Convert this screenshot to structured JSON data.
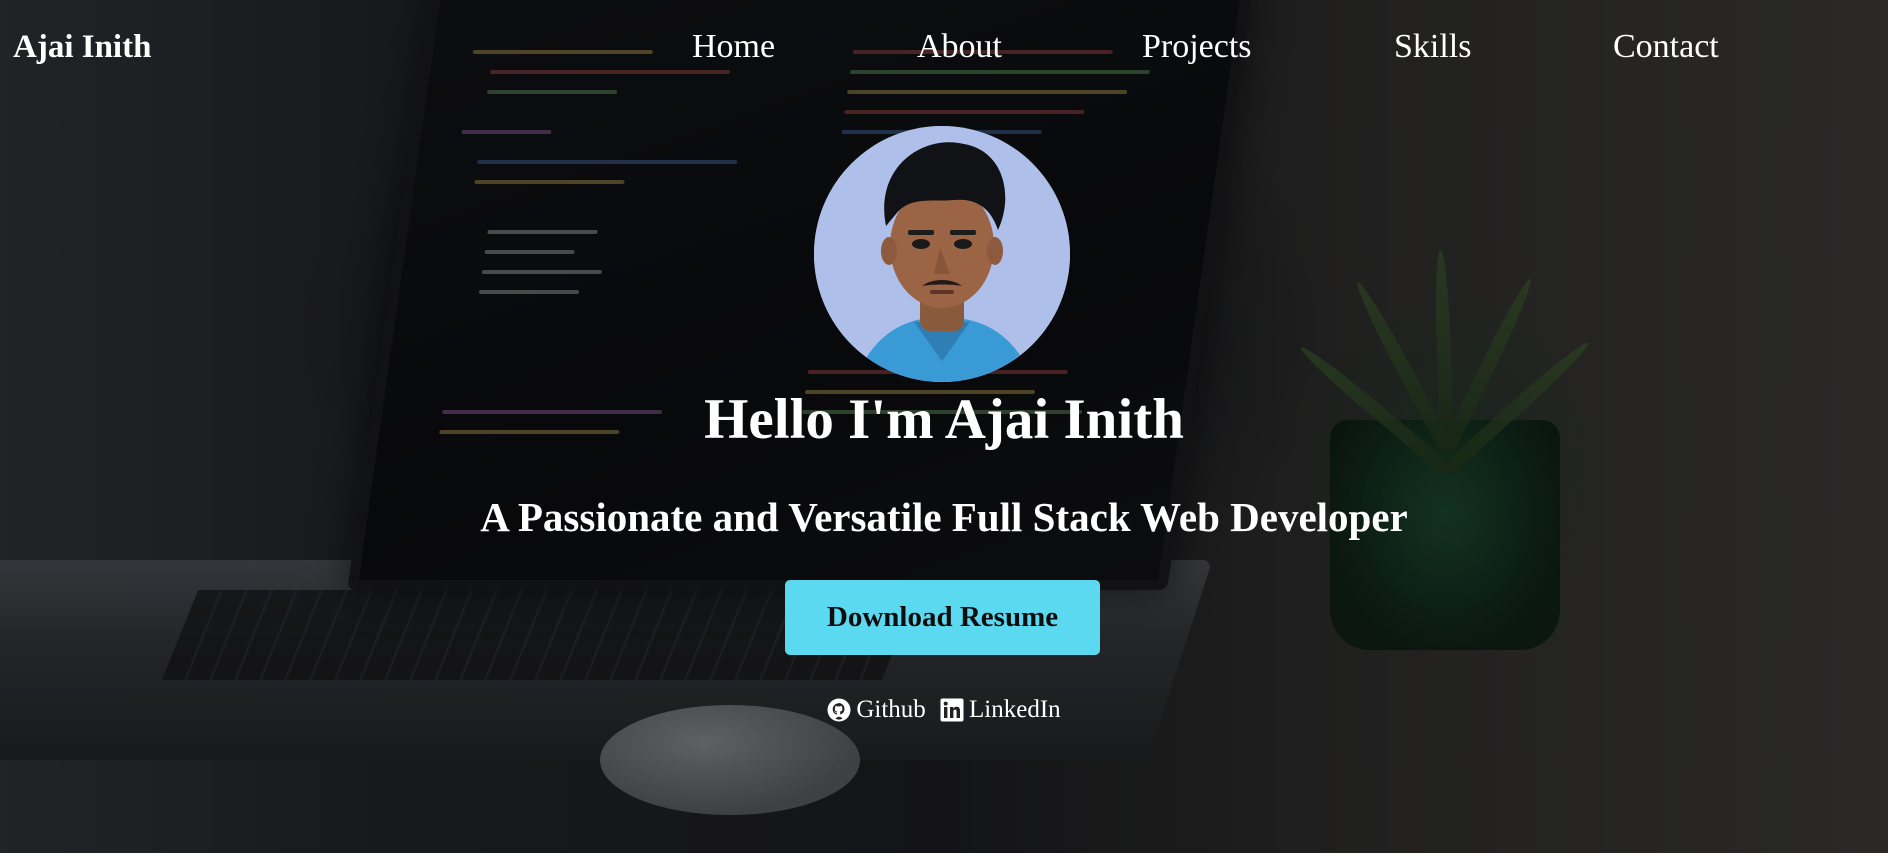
{
  "nav": {
    "brand": "Ajai Inith",
    "links": [
      {
        "label": "Home"
      },
      {
        "label": "About"
      },
      {
        "label": "Projects"
      },
      {
        "label": "Skills"
      },
      {
        "label": "Contact"
      }
    ]
  },
  "hero": {
    "headline": "Hello I'm Ajai Inith",
    "subheadline": "A Passionate and Versatile Full Stack Web Developer",
    "cta_label": "Download Resume",
    "cta_color": "#5bd9f1",
    "avatar_icon": "profile-photo"
  },
  "social": {
    "github": {
      "label": "Github",
      "icon": "github-icon"
    },
    "linkedin": {
      "label": "LinkedIn",
      "icon": "linkedin-icon"
    }
  }
}
